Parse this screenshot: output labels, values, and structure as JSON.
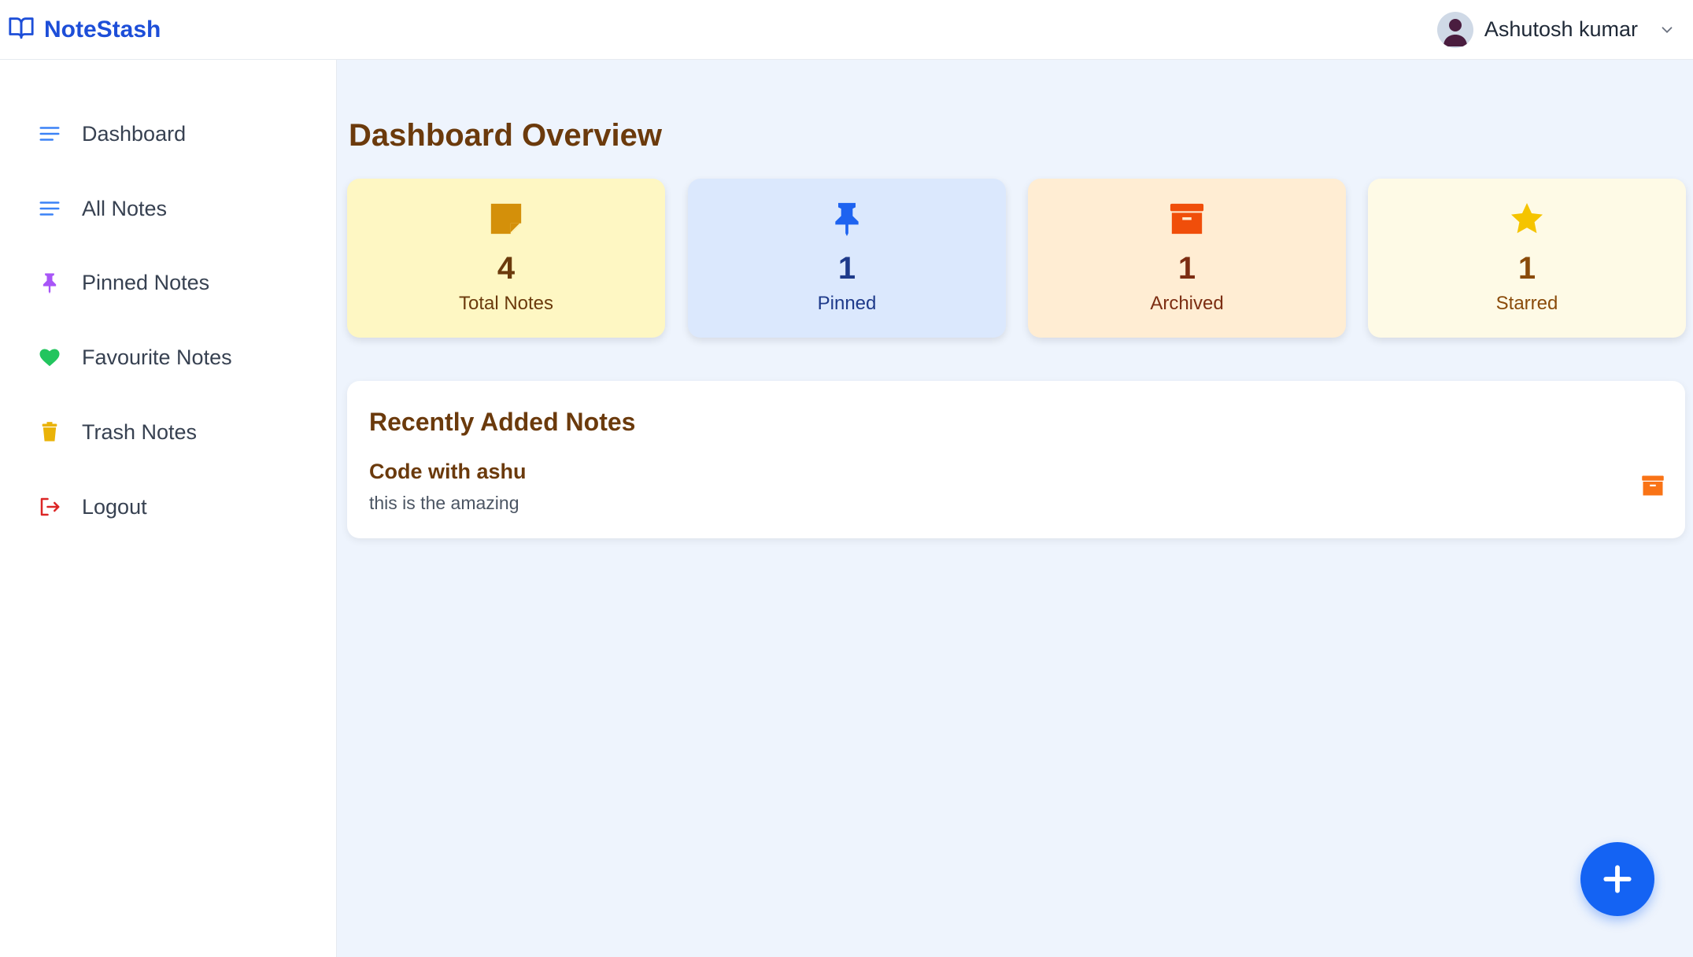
{
  "app": {
    "name": "NoteStash"
  },
  "user": {
    "name": "Ashutosh kumar"
  },
  "sidebar": {
    "items": [
      {
        "label": "Dashboard",
        "icon": "list-icon",
        "color": "#3b82f6"
      },
      {
        "label": "All Notes",
        "icon": "list-icon",
        "color": "#3b82f6"
      },
      {
        "label": "Pinned Notes",
        "icon": "pin-icon",
        "color": "#a855f7"
      },
      {
        "label": "Favourite Notes",
        "icon": "heart-icon",
        "color": "#22c55e"
      },
      {
        "label": "Trash Notes",
        "icon": "trash-icon",
        "color": "#eab308"
      },
      {
        "label": "Logout",
        "icon": "logout-icon",
        "color": "#dc2626"
      }
    ]
  },
  "main": {
    "title": "Dashboard Overview",
    "stats": [
      {
        "value": "4",
        "label": "Total Notes",
        "icon": "sticky-note-icon",
        "bg": "#fef7c3",
        "accent": "#d4900a",
        "text": "#6b3a0c"
      },
      {
        "value": "1",
        "label": "Pinned",
        "icon": "pin-icon",
        "bg": "#dbe8fd",
        "accent": "#1e63f0",
        "text": "#1e3a8a"
      },
      {
        "value": "1",
        "label": "Archived",
        "icon": "archive-icon",
        "bg": "#ffedd3",
        "accent": "#f04e0a",
        "text": "#7c2d12"
      },
      {
        "value": "1",
        "label": "Starred",
        "icon": "star-icon",
        "bg": "#fefae6",
        "accent": "#f5c400",
        "text": "#8a4b0a"
      }
    ],
    "recent": {
      "title": "Recently Added Notes",
      "notes": [
        {
          "title": "Code with ashu",
          "body": "this is the amazing"
        }
      ]
    }
  },
  "fab": {
    "icon": "plus-icon"
  }
}
